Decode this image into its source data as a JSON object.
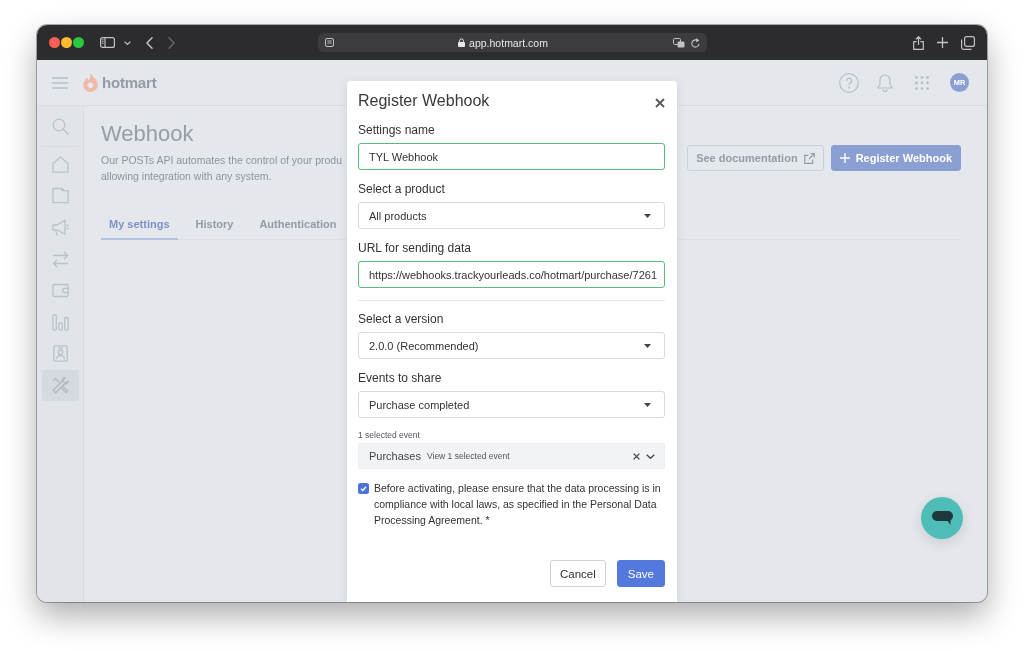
{
  "browser": {
    "url": "app.hotmart.com",
    "navigation": [
      {
        "kind": "back",
        "disabled": false
      },
      {
        "kind": "forward",
        "disabled": true
      }
    ]
  },
  "app_header": {
    "logo_text": "hotmart",
    "avatar_initials": "MR"
  },
  "sidebar": {
    "items": [
      {
        "kind": "search",
        "selected": false
      },
      {
        "kind": "home",
        "selected": false
      },
      {
        "kind": "folder",
        "selected": false
      },
      {
        "kind": "megaphone",
        "selected": false
      },
      {
        "kind": "exchange",
        "selected": false
      },
      {
        "kind": "wallet",
        "selected": false
      },
      {
        "kind": "chart",
        "selected": false
      },
      {
        "kind": "contact",
        "selected": false
      },
      {
        "kind": "tools",
        "selected": true
      }
    ]
  },
  "page": {
    "title": "Webhook",
    "description_lines": [
      "Our POSTs API automates the control of your produ",
      "allowing integration with any system."
    ],
    "tabs": [
      {
        "label": "My settings",
        "selected": true
      },
      {
        "label": "History",
        "selected": false
      },
      {
        "label": "Authentication",
        "selected": false
      }
    ],
    "buttons": [
      {
        "kind": "outline",
        "label": "See documentation"
      },
      {
        "kind": "primary",
        "label": "Register Webhook"
      }
    ]
  },
  "modal": {
    "title": "Register Webhook",
    "sections": [
      {
        "fields": [
          {
            "kind": "input",
            "label": "Settings name",
            "value": "TYL Webhook",
            "valid": true
          },
          {
            "kind": "select",
            "label": "Select a product",
            "value": "All products"
          },
          {
            "kind": "input",
            "label": "URL for sending data",
            "value": "https://webhooks.trackyourleads.co/hotmart/purchase/7261",
            "valid": true
          }
        ]
      },
      {
        "fields": [
          {
            "kind": "select",
            "label": "Select a version",
            "value": "2.0.0 (Recommended)"
          },
          {
            "kind": "select",
            "label": "Events to share",
            "value": "Purchase completed"
          }
        ]
      }
    ],
    "selected_events": {
      "caption": "1 selected event",
      "items": [
        {
          "label": "Purchases",
          "detail": "View 1 selected event"
        }
      ]
    },
    "consent": {
      "checked": true,
      "text": "Before activating, please ensure that the data processing is in compliance with local laws, as specified in the Personal Data Processing Agreement. *"
    },
    "buttons": [
      {
        "kind": "secondary",
        "label": "Cancel"
      },
      {
        "kind": "primary",
        "label": "Save"
      }
    ]
  }
}
